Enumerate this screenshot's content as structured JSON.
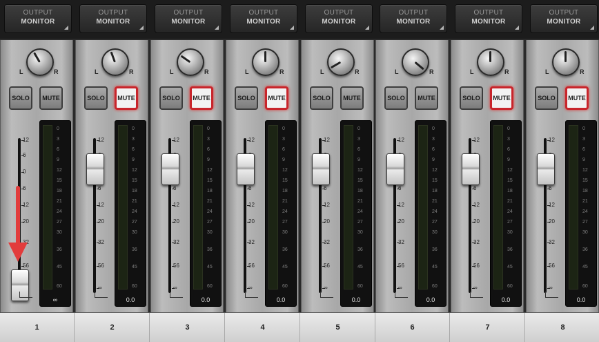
{
  "output_buttons": [
    {
      "line1": "OUTPUT",
      "line2": "MONITOR"
    },
    {
      "line1": "OUTPUT",
      "line2": "MONITOR"
    },
    {
      "line1": "OUTPUT",
      "line2": "MONITOR"
    },
    {
      "line1": "OUTPUT",
      "line2": "MONITOR"
    },
    {
      "line1": "OUTPUT",
      "line2": "MONITOR"
    },
    {
      "line1": "OUTPUT",
      "line2": "MONITOR"
    },
    {
      "line1": "OUTPUT",
      "line2": "MONITOR"
    },
    {
      "line1": "OUTPUT",
      "line2": "MONITOR"
    }
  ],
  "pan_labels": {
    "left": "L",
    "right": "R"
  },
  "fader_scale": [
    "12",
    "6",
    "0",
    "6",
    "12",
    "20",
    "32",
    "56",
    "∞"
  ],
  "meter_scale": [
    "0",
    "3",
    "6",
    "9",
    "12",
    "15",
    "18",
    "21",
    "24",
    "27",
    "30",
    "36",
    "45",
    "60"
  ],
  "channels": [
    {
      "number": "1",
      "solo_label": "SOLO",
      "mute_label": "MUTE",
      "mute_on": false,
      "readout": "∞",
      "fader_db": "-∞",
      "pan_angle": -30
    },
    {
      "number": "2",
      "solo_label": "SOLO",
      "mute_label": "MUTE",
      "mute_on": true,
      "readout": "0.0",
      "fader_db": "0",
      "pan_angle": -20
    },
    {
      "number": "3",
      "solo_label": "SOLO",
      "mute_label": "MUTE",
      "mute_on": true,
      "readout": "0.0",
      "fader_db": "0",
      "pan_angle": -55
    },
    {
      "number": "4",
      "solo_label": "SOLO",
      "mute_label": "MUTE",
      "mute_on": true,
      "readout": "0.0",
      "fader_db": "0",
      "pan_angle": 0
    },
    {
      "number": "5",
      "solo_label": "SOLO",
      "mute_label": "MUTE",
      "mute_on": false,
      "readout": "0.0",
      "fader_db": "0",
      "pan_angle": -120
    },
    {
      "number": "6",
      "solo_label": "SOLO",
      "mute_label": "MUTE",
      "mute_on": false,
      "readout": "0.0",
      "fader_db": "0",
      "pan_angle": 130
    },
    {
      "number": "7",
      "solo_label": "SOLO",
      "mute_label": "MUTE",
      "mute_on": true,
      "readout": "0.0",
      "fader_db": "0",
      "pan_angle": 0
    },
    {
      "number": "8",
      "solo_label": "SOLO",
      "mute_label": "MUTE",
      "mute_on": true,
      "readout": "0.0",
      "fader_db": "0",
      "pan_angle": 0
    }
  ],
  "colors": {
    "mute_active_border": "#c8252b",
    "annotation_arrow": "#e23c3c"
  }
}
